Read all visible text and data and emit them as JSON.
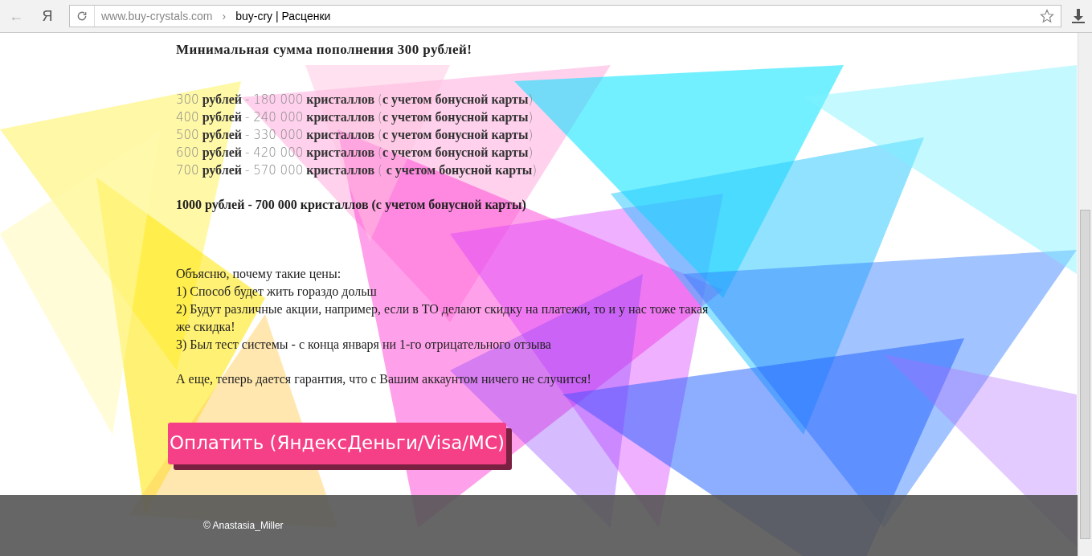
{
  "browser": {
    "domain": "www.buy-crystals.com",
    "separator": "›",
    "title": "buy-cry | Расценки",
    "back": "←",
    "yandex": "Я"
  },
  "heading": "Минимальная сумма пополнения 300 рублей!",
  "price_lines": [
    [
      {
        "kind": "num",
        "text": "300"
      },
      {
        "kind": "word",
        "text": " рублей "
      },
      {
        "kind": "num",
        "text": "- 180 000"
      },
      {
        "kind": "word",
        "text": " кристаллов "
      },
      {
        "kind": "num",
        "text": "("
      },
      {
        "kind": "word",
        "text": "с учетом бонусной карты"
      },
      {
        "kind": "num",
        "text": ")"
      }
    ],
    [
      {
        "kind": "num",
        "text": "400"
      },
      {
        "kind": "word",
        "text": " рублей "
      },
      {
        "kind": "num",
        "text": "- 240 000"
      },
      {
        "kind": "word",
        "text": " кристаллов "
      },
      {
        "kind": "num",
        "text": "("
      },
      {
        "kind": "word",
        "text": "с учетом бонусной карты"
      },
      {
        "kind": "num",
        "text": ")"
      }
    ],
    [
      {
        "kind": "num",
        "text": "500"
      },
      {
        "kind": "word",
        "text": " рублей "
      },
      {
        "kind": "num",
        "text": "- 330 000"
      },
      {
        "kind": "word",
        "text": " кристаллов "
      },
      {
        "kind": "num",
        "text": "("
      },
      {
        "kind": "word",
        "text": "с учетом бонусной карты"
      },
      {
        "kind": "num",
        "text": ")"
      }
    ],
    [
      {
        "kind": "num",
        "text": "600"
      },
      {
        "kind": "word",
        "text": " рублей "
      },
      {
        "kind": "num",
        "text": "- 420 000"
      },
      {
        "kind": "word",
        "text": " кристаллов "
      },
      {
        "kind": "num",
        "text": "("
      },
      {
        "kind": "word",
        "text": "с учетом бонусной карты"
      },
      {
        "kind": "num",
        "text": ")"
      }
    ],
    [
      {
        "kind": "num",
        "text": "700"
      },
      {
        "kind": "word",
        "text": " рублей "
      },
      {
        "kind": "num",
        "text": "- 570 000"
      },
      {
        "kind": "word",
        "text": " кристаллов "
      },
      {
        "kind": "num",
        "text": "( "
      },
      {
        "kind": "word",
        "text": "с учетом бонусной карты"
      },
      {
        "kind": "num",
        "text": ")"
      }
    ]
  ],
  "special_offer": "1000 рублей - 700 000 кристаллов (с учетом бонусной карты)",
  "explanation": [
    "Объясню, почему такие цены:",
    "1) Способ будет жить гораздо дольш",
    "2) Будут различные акции, например, если в ТО делают скидку на платежи, то и у нас тоже такая же скидка!",
    "3) Был тест системы - с конца января ни 1-го отрицательного отзыва"
  ],
  "guarantee": "А еще, теперь дается гарантия, что с Вашим аккаунтом ничего не случится!",
  "pay_button": "Оплатить (ЯндексДеньги/Visa/MC)",
  "footer": "© Anastasia_Miller"
}
